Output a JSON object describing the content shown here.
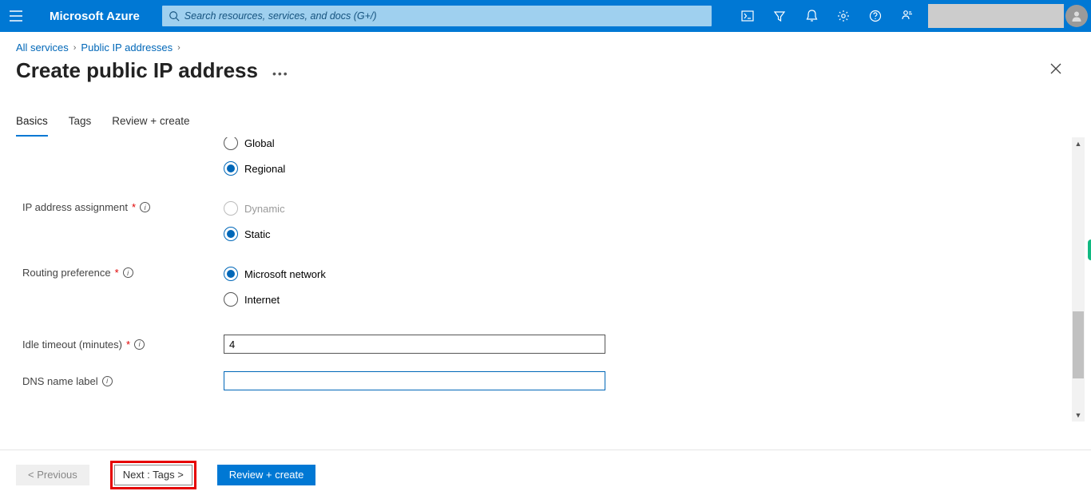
{
  "header": {
    "brand": "Microsoft Azure",
    "search_placeholder": "Search resources, services, and docs (G+/)"
  },
  "breadcrumb": {
    "items": [
      "All services",
      "Public IP addresses"
    ]
  },
  "page": {
    "title": "Create public IP address"
  },
  "tabs": {
    "items": [
      "Basics",
      "Tags",
      "Review + create"
    ],
    "active_index": 0
  },
  "form": {
    "tier": {
      "options": [
        "Global",
        "Regional"
      ],
      "selected": "Regional"
    },
    "ip_assignment": {
      "label": "IP address assignment",
      "options": [
        "Dynamic",
        "Static"
      ],
      "selected": "Static",
      "disabled": [
        "Dynamic"
      ]
    },
    "routing_pref": {
      "label": "Routing preference",
      "options": [
        "Microsoft network",
        "Internet"
      ],
      "selected": "Microsoft network"
    },
    "idle_timeout": {
      "label": "Idle timeout (minutes)",
      "value": "4"
    },
    "dns_label": {
      "label": "DNS name label",
      "value": ""
    }
  },
  "footer": {
    "prev": "< Previous",
    "next": "Next : Tags >",
    "review": "Review + create"
  }
}
